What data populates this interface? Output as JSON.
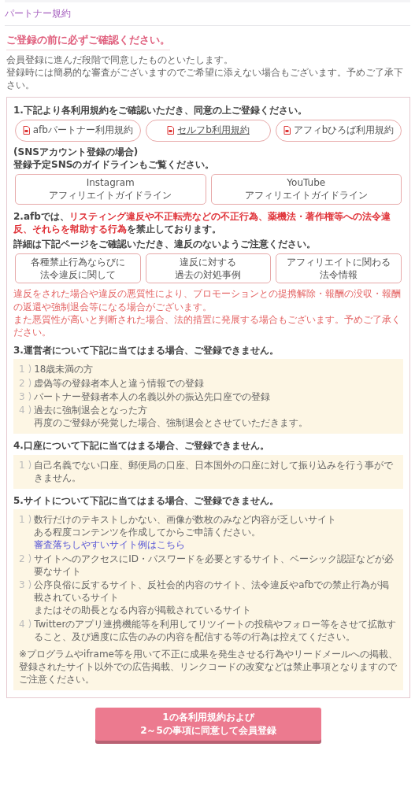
{
  "page_title": "パートナー規約",
  "notice": {
    "heading": "ご登録の前に必ずご確認ください。",
    "lines": [
      "会員登録に進んだ段階で同意したものといたします。",
      "登録時には簡易的な審査がございますのでご希望に添えない場合もございます。予めご了承下さい。"
    ]
  },
  "sections": [
    {
      "kind": "terms",
      "heading": "1.下記より各利用規約をご確認いただき、同意の上ご登録ください。",
      "links": [
        {
          "label": "afbパートナー利用規約",
          "underlined": false
        },
        {
          "label": "セルフb利用規約",
          "underlined": true
        },
        {
          "label": "アフィbひろば利用規約",
          "underlined": false
        }
      ],
      "sns_note": [
        "(SNSアカウント登録の場合)",
        "登録予定SNSのガイドラインもご覧ください。"
      ],
      "guidelines": [
        {
          "platform": "Instagram",
          "label": "アフィリエイトガイドライン"
        },
        {
          "platform": "YouTube",
          "label": "アフィリエイトガイドライン"
        }
      ]
    },
    {
      "kind": "violations",
      "heading": [
        {
          "text": "2.afbでは、",
          "emphasis": false
        },
        {
          "text": "リスティング違反や不正転売などの不正行為、薬機法・著作権等への法令違反、それらを幇助する行為",
          "emphasis": true
        },
        {
          "text": "を禁止しております。",
          "emphasis": false
        }
      ],
      "detail": "詳細は下記ページをご確認いただき、違反のないようご注意ください。",
      "links": [
        [
          "各種禁止行為ならびに",
          "法令違反に関して"
        ],
        [
          "違反に対する",
          "過去の対処事例"
        ],
        [
          "アフィリエイトに関わる",
          "法令情報"
        ]
      ],
      "warnings": [
        "違反をされた場合や違反の悪質性により、プロモーションとの提携解除・報酬の没収・報酬の返還や強制退会等になる場合がございます。",
        "また悪質性が高いと判断された場合、法的措置に発展する場合もございます。予めご了承ください。"
      ]
    },
    {
      "kind": "list",
      "heading": "3.運営者について下記に当てはまる場合、ご登録できません。",
      "items": [
        {
          "number": "1 )",
          "lines": [
            "18歳未満の方"
          ]
        },
        {
          "number": "2 )",
          "lines": [
            "虚偽等の登録者本人と違う情報での登録"
          ]
        },
        {
          "number": "3 )",
          "lines": [
            "パートナー登録者本人の名義以外の振込先口座での登録"
          ]
        },
        {
          "number": "4 )",
          "lines": [
            "過去に強制退会となった方",
            "再度のご登録が発覚した場合、強制退会とさせていただきます。"
          ]
        }
      ]
    },
    {
      "kind": "list",
      "heading": "4.口座について下記に当てはまる場合、ご登録できません。",
      "items": [
        {
          "number": "1 )",
          "lines": [
            "自己名義でない口座、郵便局の口座、日本国外の口座に対して振り込みを行う事ができません。"
          ]
        }
      ]
    },
    {
      "kind": "list",
      "heading": "5.サイトについて下記に当てはまる場合、ご登録できません。",
      "items": [
        {
          "number": "1 )",
          "lines": [
            "数行だけのテキストしかない、画像が数枚のみなど内容が乏しいサイト",
            "ある程度コンテンツを作成してからご申請ください。"
          ],
          "link": "審査落ちしやすいサイト例はこちら"
        },
        {
          "number": "2 )",
          "lines": [
            "サイトへのアクセスにID・パスワードを必要とするサイト、ベーシック認証などが必要なサイト"
          ]
        },
        {
          "number": "3 )",
          "lines": [
            "公序良俗に反するサイト、反社会的内容のサイト、法令違反やafbでの禁止行為が掲載されているサイト",
            "またはその助長となる内容が掲載されているサイト"
          ]
        },
        {
          "number": "4 )",
          "lines": [
            "Twitterのアプリ連携機能等を利用してリツイートの投稿やフォロー等をさせて拡散すること、及び過度に広告のみの内容を配信する等の行為は控えてください。"
          ]
        }
      ],
      "note": "※プログラムやiframe等を用いて不正に成果を発生させる行為やリードメールへの掲載、登録されたサイト以外での広告掲載、リンクコードの改変などは禁止事項となりますのでご注意ください。"
    }
  ],
  "submit_button": [
    "1の各利用規約および",
    "2～5の事項に同意して会員登録"
  ]
}
